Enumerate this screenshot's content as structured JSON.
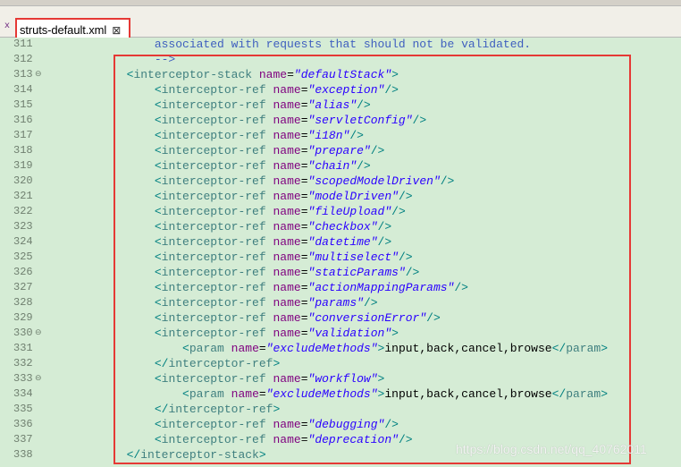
{
  "tab": {
    "label": "struts-default.xml",
    "close_glyph": "⊠",
    "file_icon_glyph": "x"
  },
  "fold_glyph": "⊖",
  "watermark": "https://blog.csdn.net/qq_40762011",
  "lines": [
    {
      "n": "311",
      "indent": "                ",
      "comment": "associated with requests that should not be validated."
    },
    {
      "n": "312",
      "indent": "                ",
      "comment": "-->"
    },
    {
      "n": "313",
      "indent": "            ",
      "tag": "interceptor-stack",
      "attr": "name",
      "val": "defaultStack",
      "close": ">",
      "fold": true
    },
    {
      "n": "314",
      "indent": "                ",
      "tag": "interceptor-ref",
      "attr": "name",
      "val": "exception",
      "close": "/>"
    },
    {
      "n": "315",
      "indent": "                ",
      "tag": "interceptor-ref",
      "attr": "name",
      "val": "alias",
      "close": "/>"
    },
    {
      "n": "316",
      "indent": "                ",
      "tag": "interceptor-ref",
      "attr": "name",
      "val": "servletConfig",
      "close": "/>"
    },
    {
      "n": "317",
      "indent": "                ",
      "tag": "interceptor-ref",
      "attr": "name",
      "val": "i18n",
      "close": "/>"
    },
    {
      "n": "318",
      "indent": "                ",
      "tag": "interceptor-ref",
      "attr": "name",
      "val": "prepare",
      "close": "/>"
    },
    {
      "n": "319",
      "indent": "                ",
      "tag": "interceptor-ref",
      "attr": "name",
      "val": "chain",
      "close": "/>"
    },
    {
      "n": "320",
      "indent": "                ",
      "tag": "interceptor-ref",
      "attr": "name",
      "val": "scopedModelDriven",
      "close": "/>"
    },
    {
      "n": "321",
      "indent": "                ",
      "tag": "interceptor-ref",
      "attr": "name",
      "val": "modelDriven",
      "close": "/>"
    },
    {
      "n": "322",
      "indent": "                ",
      "tag": "interceptor-ref",
      "attr": "name",
      "val": "fileUpload",
      "close": "/>"
    },
    {
      "n": "323",
      "indent": "                ",
      "tag": "interceptor-ref",
      "attr": "name",
      "val": "checkbox",
      "close": "/>"
    },
    {
      "n": "324",
      "indent": "                ",
      "tag": "interceptor-ref",
      "attr": "name",
      "val": "datetime",
      "close": "/>"
    },
    {
      "n": "325",
      "indent": "                ",
      "tag": "interceptor-ref",
      "attr": "name",
      "val": "multiselect",
      "close": "/>"
    },
    {
      "n": "326",
      "indent": "                ",
      "tag": "interceptor-ref",
      "attr": "name",
      "val": "staticParams",
      "close": "/>"
    },
    {
      "n": "327",
      "indent": "                ",
      "tag": "interceptor-ref",
      "attr": "name",
      "val": "actionMappingParams",
      "close": "/>"
    },
    {
      "n": "328",
      "indent": "                ",
      "tag": "interceptor-ref",
      "attr": "name",
      "val": "params",
      "close": "/>"
    },
    {
      "n": "329",
      "indent": "                ",
      "tag": "interceptor-ref",
      "attr": "name",
      "val": "conversionError",
      "close": "/>"
    },
    {
      "n": "330",
      "indent": "                ",
      "tag": "interceptor-ref",
      "attr": "name",
      "val": "validation",
      "close": ">",
      "fold": true
    },
    {
      "n": "331",
      "indent": "                    ",
      "tag": "param",
      "attr": "name",
      "val": "excludeMethods",
      "close": ">",
      "text": "input,back,cancel,browse",
      "end": "param"
    },
    {
      "n": "332",
      "indent": "                ",
      "endtag": "interceptor-ref"
    },
    {
      "n": "333",
      "indent": "                ",
      "tag": "interceptor-ref",
      "attr": "name",
      "val": "workflow",
      "close": ">",
      "fold": true
    },
    {
      "n": "334",
      "indent": "                    ",
      "tag": "param",
      "attr": "name",
      "val": "excludeMethods",
      "close": ">",
      "text": "input,back,cancel,browse",
      "end": "param"
    },
    {
      "n": "335",
      "indent": "                ",
      "endtag": "interceptor-ref"
    },
    {
      "n": "336",
      "indent": "                ",
      "tag": "interceptor-ref",
      "attr": "name",
      "val": "debugging",
      "close": "/>"
    },
    {
      "n": "337",
      "indent": "                ",
      "tag": "interceptor-ref",
      "attr": "name",
      "val": "deprecation",
      "close": "/>"
    },
    {
      "n": "338",
      "indent": "            ",
      "endtag": "interceptor-stack"
    }
  ]
}
